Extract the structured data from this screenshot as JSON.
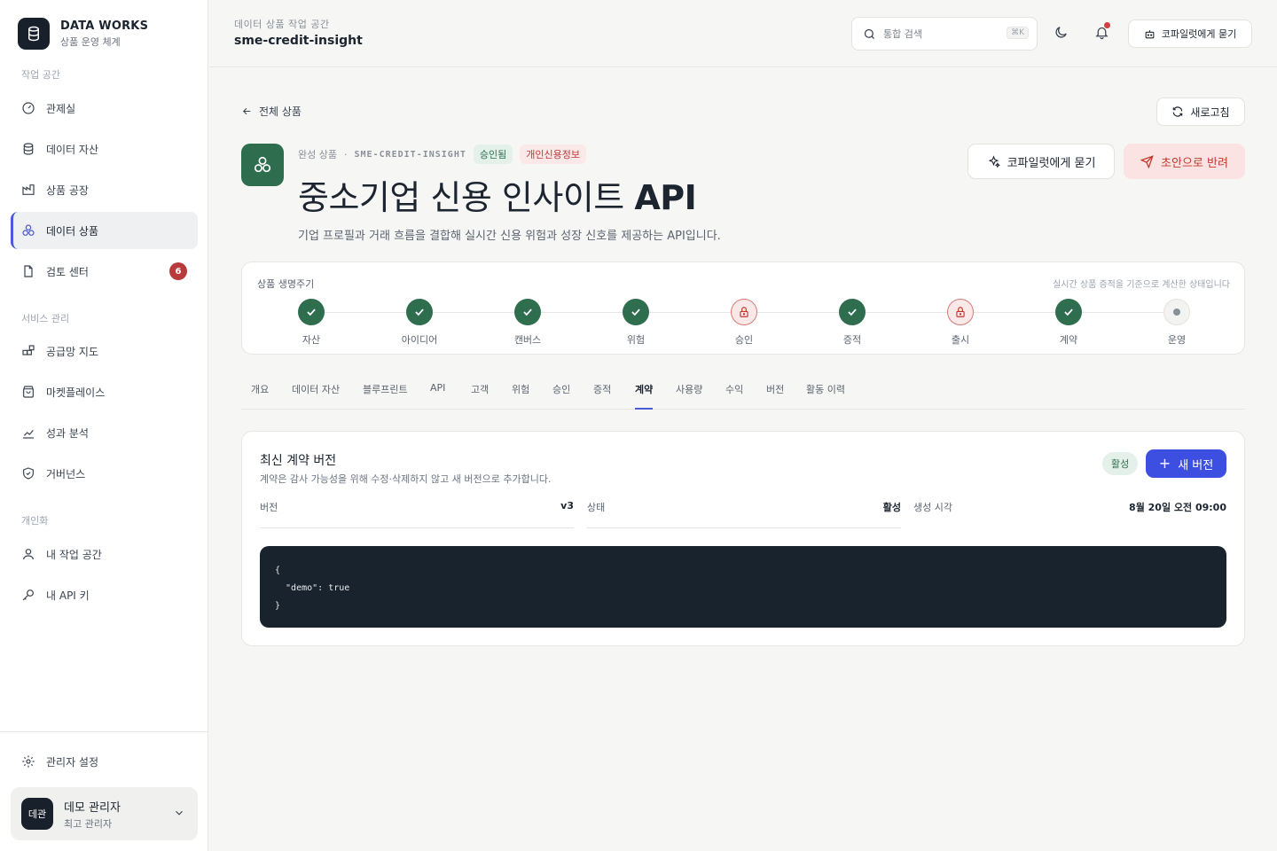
{
  "brand": {
    "title": "DATA WORKS",
    "subtitle": "상품 운영 체계"
  },
  "sidebar": {
    "sections": [
      "작업 공간",
      "서비스 관리",
      "개인화"
    ],
    "items": [
      {
        "label": "관제실",
        "icon": "gauge-icon"
      },
      {
        "label": "데이터 자산",
        "icon": "database-icon"
      },
      {
        "label": "상품 공장",
        "icon": "factory-icon"
      },
      {
        "label": "데이터 상품",
        "icon": "cluster-icon",
        "active": true
      },
      {
        "label": "검토 센터",
        "icon": "document-icon",
        "badge": "6"
      },
      {
        "label": "공급망 지도",
        "icon": "grid-icon"
      },
      {
        "label": "마켓플레이스",
        "icon": "bag-icon"
      },
      {
        "label": "성과 분석",
        "icon": "chart-icon"
      },
      {
        "label": "거버넌스",
        "icon": "shield-icon"
      },
      {
        "label": "내 작업 공간",
        "icon": "user-icon"
      },
      {
        "label": "내 API 키",
        "icon": "key-icon"
      }
    ],
    "admin": "관리자 설정",
    "user": {
      "initials": "데관",
      "name": "데모 관리자",
      "role": "최고 관리자"
    }
  },
  "topbar": {
    "workspace_label": "데이터 상품 작업 공간",
    "workspace_name": "sme-credit-insight",
    "search_placeholder": "통합 검색",
    "search_shortcut": "⌘K",
    "copilot_label": "코파일럿에게 묻기"
  },
  "header": {
    "back_label": "전체 상품",
    "refresh_label": "새로고침",
    "meta_stage": "완성 상품",
    "meta_sep": "·",
    "meta_code": "SME-CREDIT-INSIGHT",
    "tag_approved": "승인됨",
    "tag_pii": "개인신용정보",
    "title_main": "중소기업 신용 인사이트 ",
    "title_bold": "API",
    "description": "기업 프로필과 거래 흐름을 결합해 실시간 신용 위험과 성장 신호를 제공하는 API입니다.",
    "copilot_label": "코파일럿에게 묻기",
    "return_label": "초안으로 반려"
  },
  "lifecycle": {
    "title": "상품 생명주기",
    "note": "실시간 상품 증적을 기준으로 계산한 상태입니다",
    "steps": [
      {
        "label": "자산",
        "state": "done"
      },
      {
        "label": "아이디어",
        "state": "done"
      },
      {
        "label": "캔버스",
        "state": "done"
      },
      {
        "label": "위험",
        "state": "done"
      },
      {
        "label": "승인",
        "state": "locked"
      },
      {
        "label": "증적",
        "state": "done"
      },
      {
        "label": "출시",
        "state": "locked"
      },
      {
        "label": "계약",
        "state": "done"
      },
      {
        "label": "운영",
        "state": "pending"
      }
    ]
  },
  "tabs": [
    "개요",
    "데이터 자산",
    "블루프린트",
    "API",
    "고객",
    "위험",
    "승인",
    "증적",
    "계약",
    "사용량",
    "수익",
    "버전",
    "활동 이력"
  ],
  "active_tab": "계약",
  "contract": {
    "title": "최신 계약 버전",
    "subtitle": "계약은 감사 가능성을 위해 수정·삭제하지 않고 새 버전으로 추가합니다.",
    "status": "활성",
    "new_version_label": "새 버전",
    "fields": [
      {
        "key": "버전",
        "value": "v3"
      },
      {
        "key": "상태",
        "value": "활성"
      },
      {
        "key": "생성 시각",
        "value": "8월 20일 오전 09:00"
      }
    ],
    "code": "{\n  \"demo\": true\n}"
  },
  "colors": {
    "accent": "#3d4fe0",
    "brand_dark": "#17202b",
    "success": "#2e6e4f",
    "danger": "#c0392b"
  }
}
